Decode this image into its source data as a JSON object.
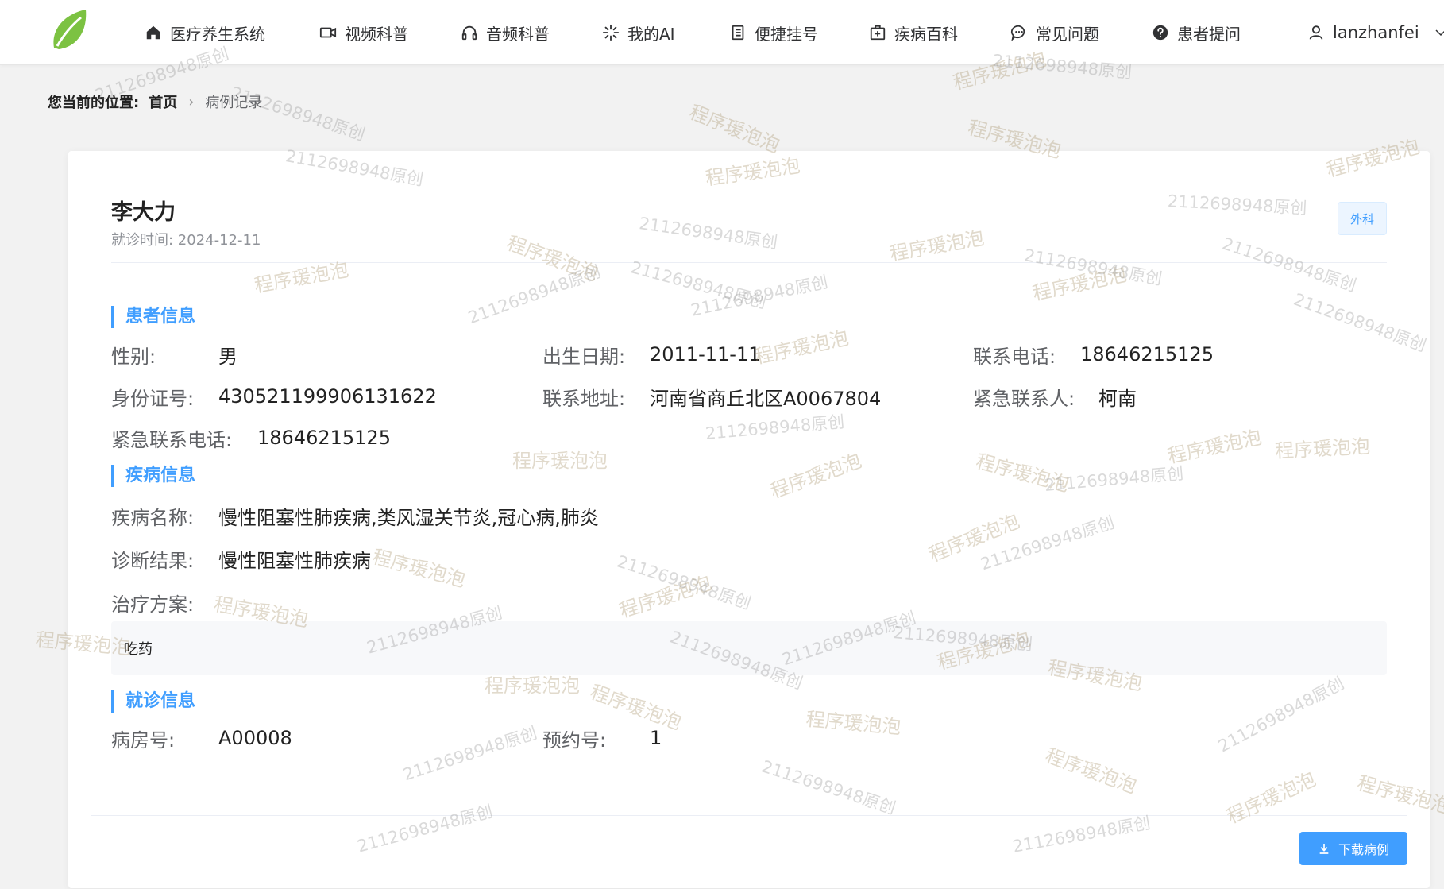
{
  "nav": {
    "items": [
      {
        "label": "医疗养生系统",
        "icon": "home-icon"
      },
      {
        "label": "视频科普",
        "icon": "video-icon"
      },
      {
        "label": "音频科普",
        "icon": "headphones-icon"
      },
      {
        "label": "我的AI",
        "icon": "sparkle-icon"
      },
      {
        "label": "便捷挂号",
        "icon": "notebook-icon"
      },
      {
        "label": "疾病百科",
        "icon": "medical-box-icon"
      },
      {
        "label": "常见问题",
        "icon": "chat-icon"
      },
      {
        "label": "患者提问",
        "icon": "question-icon"
      }
    ],
    "username": "lanzhanfei"
  },
  "breadcrumb": {
    "prefix": "您当前的位置:",
    "home": "首页",
    "current": "病例记录"
  },
  "record": {
    "patient_name": "李大力",
    "visit_time": "就诊时间: 2024-12-11",
    "department_tag": "外科",
    "sections": {
      "patient_info": "患者信息",
      "disease_info": "疾病信息",
      "visit_info": "就诊信息"
    },
    "patient": {
      "gender_label": "性别:",
      "gender": "男",
      "birth_label": "出生日期:",
      "birth": "2011-11-11",
      "phone_label": "联系电话:",
      "phone": "18646215125",
      "id_label": "身份证号:",
      "id_number": "430521199906131622",
      "address_label": "联系地址:",
      "address": "河南省商丘北区A0067804",
      "emergency_contact_label": "紧急联系人:",
      "emergency_contact": "柯南",
      "emergency_phone_label": "紧急联系电话:",
      "emergency_phone": "18646215125"
    },
    "disease": {
      "name_label": "疾病名称:",
      "name": "慢性阻塞性肺疾病,类风湿关节炎,冠心病,肺炎",
      "diagnosis_label": "诊断结果:",
      "diagnosis": "慢性阻塞性肺疾病",
      "plan_label": "治疗方案:",
      "plan": "吃药"
    },
    "visit": {
      "ward_label": "病房号:",
      "ward": "A00008",
      "appointment_label": "预约号:",
      "appointment": "1"
    },
    "download_label": "下载病例"
  },
  "watermark": {
    "text_cn": "程序瑗泡泡",
    "text_num": "2112698948原创"
  },
  "colors": {
    "accent": "#409eff",
    "logo_green": "#7cc242"
  }
}
